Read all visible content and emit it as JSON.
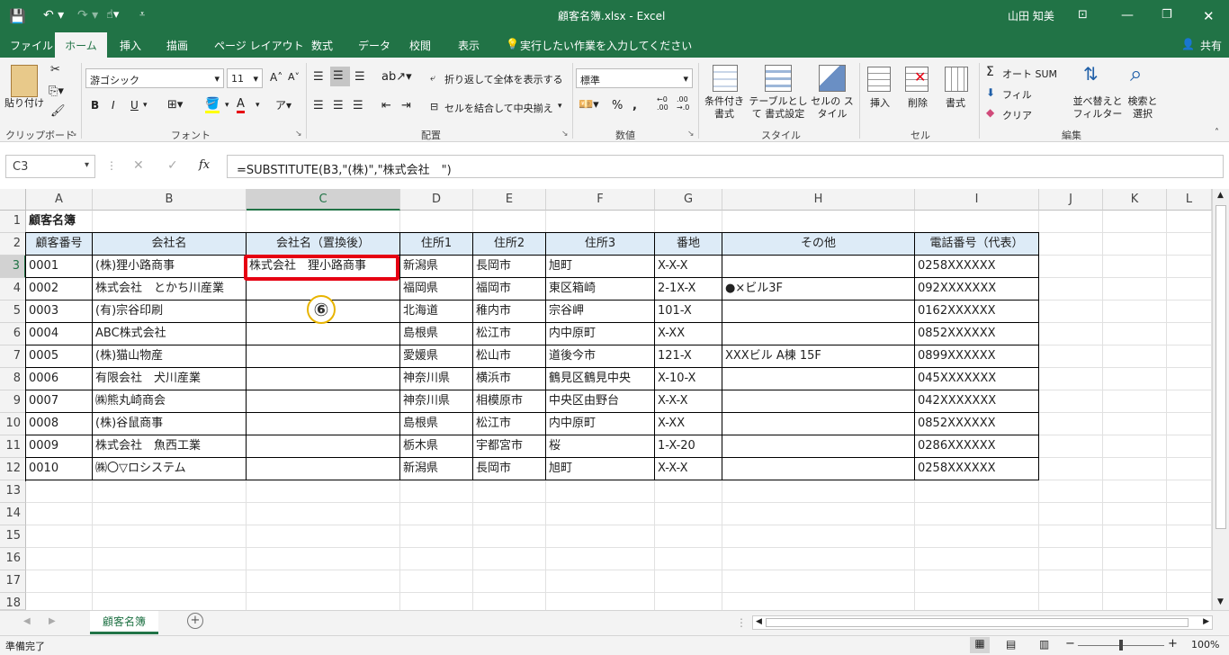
{
  "title": {
    "file": "顧客名簿.xlsx  -  Excel",
    "user": "山田 知美"
  },
  "menu": [
    "ファイル",
    "ホーム",
    "挿入",
    "描画",
    "ページ レイアウト",
    "数式",
    "データ",
    "校閲",
    "表示"
  ],
  "tell_me": "実行したい作業を入力してください",
  "share": "共有",
  "ribbon": {
    "clipboard": {
      "paste": "貼り付け",
      "group": "クリップボード"
    },
    "font": {
      "name": "游ゴシック",
      "size": "11",
      "group": "フォント",
      "bold": "B",
      "italic": "I",
      "underline": "U"
    },
    "alignment": {
      "wrap": "折り返して全体を表示する",
      "merge": "セルを結合して中央揃え",
      "group": "配置"
    },
    "number": {
      "format": "標準",
      "group": "数値",
      "percent": "%"
    },
    "styles": {
      "cond": "条件付き 書式",
      "table": "テーブルとして 書式設定",
      "cell": "セルの スタイル",
      "group": "スタイル"
    },
    "cells": {
      "insert": "挿入",
      "delete": "削除",
      "format": "書式",
      "group": "セル"
    },
    "editing": {
      "autosum": "オート SUM",
      "fill": "フィル",
      "clear": "クリア",
      "sort": "並べ替えと フィルター",
      "find": "検索と 選択",
      "group": "編集"
    }
  },
  "formula_bar": {
    "name_box": "C3",
    "fx": "fx",
    "formula": "=SUBSTITUTE(B3,\"(株)\",\"株式会社　\")"
  },
  "columns": [
    "A",
    "B",
    "C",
    "D",
    "E",
    "F",
    "G",
    "H",
    "I",
    "J",
    "K",
    "L"
  ],
  "rows": [
    "1",
    "2",
    "3",
    "4",
    "5",
    "6",
    "7",
    "8",
    "9",
    "10",
    "11",
    "12",
    "13",
    "14",
    "15",
    "16",
    "17",
    "18"
  ],
  "cells": {
    "a1": "顧客名簿",
    "headers": [
      "顧客番号",
      "会社名",
      "会社名（置換後）",
      "住所1",
      "住所2",
      "住所3",
      "番地",
      "その他",
      "電話番号（代表）"
    ],
    "data": [
      [
        "0001",
        "(株)狸小路商事",
        "株式会社　狸小路商事",
        "新潟県",
        "長岡市",
        "旭町",
        "X-X-X",
        "",
        "0258XXXXXX"
      ],
      [
        "0002",
        "株式会社　とかち川産業",
        "",
        "福岡県",
        "福岡市",
        "東区箱崎",
        "2-1X-X",
        "●×ビル3F",
        "092XXXXXXX"
      ],
      [
        "0003",
        "(有)宗谷印刷",
        "",
        "北海道",
        "稚内市",
        "宗谷岬",
        "101-X",
        "",
        "0162XXXXXX"
      ],
      [
        "0004",
        "ABC株式会社",
        "",
        "島根県",
        "松江市",
        "内中原町",
        "X-XX",
        "",
        "0852XXXXXX"
      ],
      [
        "0005",
        "(株)猫山物産",
        "",
        "愛媛県",
        "松山市",
        "道後今市",
        "121-X",
        "XXXビル A棟 15F",
        "0899XXXXXX"
      ],
      [
        "0006",
        "有限会社　犬川産業",
        "",
        "神奈川県",
        "横浜市",
        "鶴見区鶴見中央",
        "X-10-X",
        "",
        "045XXXXXXX"
      ],
      [
        "0007",
        "㈱熊丸崎商会",
        "",
        "神奈川県",
        "相模原市",
        "中央区由野台",
        "X-X-X",
        "",
        "042XXXXXXX"
      ],
      [
        "0008",
        "(株)谷鼠商事",
        "",
        "島根県",
        "松江市",
        "内中原町",
        "X-XX",
        "",
        "0852XXXXXX"
      ],
      [
        "0009",
        "株式会社　魚西工業",
        "",
        "栃木県",
        "宇都宮市",
        "桜",
        "1-X-20",
        "",
        "0286XXXXXX"
      ],
      [
        "0010",
        "㈱〇▽ロシステム",
        "",
        "新潟県",
        "長岡市",
        "旭町",
        "X-X-X",
        "",
        "0258XXXXXX"
      ]
    ]
  },
  "annotation": "⑥",
  "sheet_tab": "顧客名簿",
  "status": {
    "ready": "準備完了",
    "zoom": "100%"
  },
  "colors": {
    "excel_green": "#217346",
    "header_fill": "#ddebf7",
    "highlight_red": "#e60012"
  }
}
